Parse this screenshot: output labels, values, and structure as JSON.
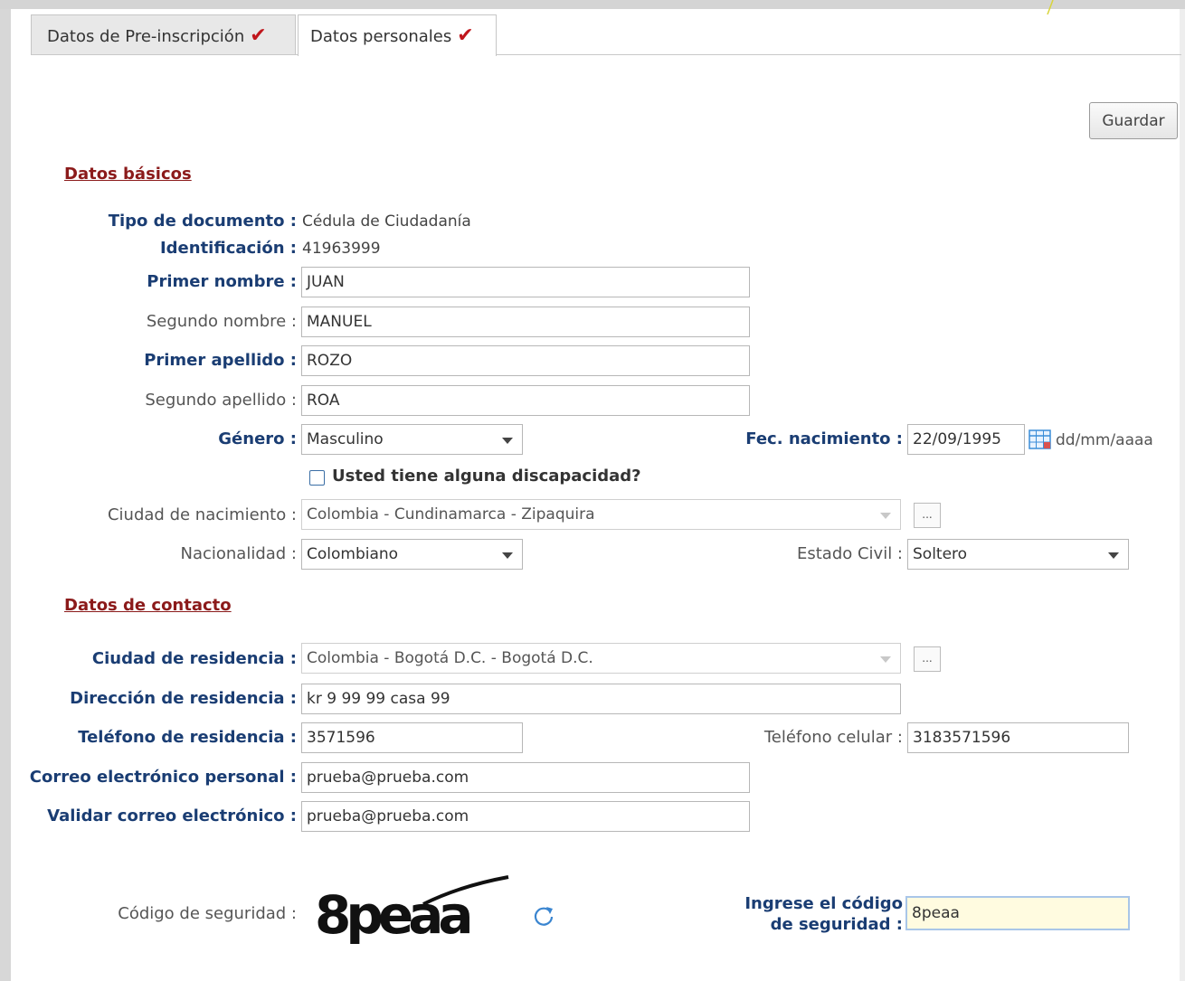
{
  "tabs": [
    {
      "label": "Datos de Pre-inscripción",
      "check": "✔"
    },
    {
      "label": "Datos personales",
      "check": "✔"
    }
  ],
  "toolbar": {
    "save_label": "Guardar"
  },
  "basic": {
    "section_title": "Datos básicos",
    "tipo_documento_label": "Tipo de documento :",
    "tipo_documento_value": "Cédula de Ciudadanía",
    "identificacion_label": "Identificación :",
    "identificacion_value": "41963999",
    "primer_nombre_label": "Primer nombre :",
    "primer_nombre_value": "JUAN",
    "segundo_nombre_label": "Segundo nombre :",
    "segundo_nombre_value": "MANUEL",
    "primer_apellido_label": "Primer apellido :",
    "primer_apellido_value": "ROZO",
    "segundo_apellido_label": "Segundo apellido :",
    "segundo_apellido_value": "ROA",
    "genero_label": "Género :",
    "genero_value": "Masculino",
    "fec_nacimiento_label": "Fec. nacimiento :",
    "fec_nacimiento_value": "22/09/1995",
    "date_format_hint": "dd/mm/aaaa",
    "discapacidad_label": "Usted tiene alguna discapacidad?",
    "ciudad_nacimiento_label": "Ciudad de nacimiento :",
    "ciudad_nacimiento_value": "Colombia - Cundinamarca - Zipaquira",
    "nacionalidad_label": "Nacionalidad :",
    "nacionalidad_value": "Colombiano",
    "estado_civil_label": "Estado Civil :",
    "estado_civil_value": "Soltero",
    "ellipsis": "..."
  },
  "contact": {
    "section_title": "Datos de contacto",
    "ciudad_residencia_label": "Ciudad de residencia :",
    "ciudad_residencia_value": "Colombia - Bogotá D.C. - Bogotá D.C.",
    "direccion_label": "Dirección de residencia :",
    "direccion_value": "kr 9 99 99 casa 99",
    "telefono_label": "Teléfono de residencia :",
    "telefono_value": "3571596",
    "celular_label": "Teléfono celular :",
    "celular_value": "3183571596",
    "correo_label": "Correo electrónico personal :",
    "correo_value": "prueba@prueba.com",
    "validar_correo_label": "Validar correo electrónico :",
    "validar_correo_value": "prueba@prueba.com"
  },
  "security": {
    "codigo_label": "Código de seguridad :",
    "captcha_text": "8peaa",
    "ingrese_label_1": "Ingrese el código",
    "ingrese_label_2": "de seguridad :",
    "ingrese_value": "8peaa"
  },
  "colors": {
    "required_label": "#1a3d73",
    "section_title": "#8b1a1a",
    "check": "#c0161c",
    "captcha_bg": "#fffbe0"
  }
}
